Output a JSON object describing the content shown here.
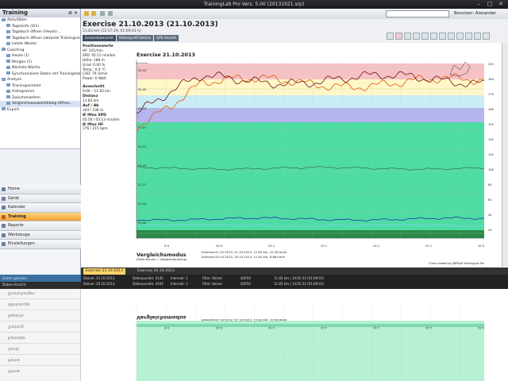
{
  "window": {
    "title": "TrainingLab Pro Vers. 5.00 (20131021.srp)"
  },
  "sidebar": {
    "title": "Training",
    "tree": [
      {
        "label": "Aktivitäten",
        "sel": false
      },
      {
        "label": "Tagesinfo (0/1)",
        "sel": false
      },
      {
        "label": "Tagebuch öffnen (Heute)...",
        "sel": false
      },
      {
        "label": "Tagebuch öffnen (aktuelle Trainingseinhe...",
        "sel": false
      },
      {
        "label": "Letzte Woche",
        "sel": false
      },
      {
        "label": "Coaching",
        "sel": false
      },
      {
        "label": "Heute (1)",
        "sel": false
      },
      {
        "label": "Morgen (1)",
        "sel": false
      },
      {
        "label": "Nächste Woche",
        "sel": false
      },
      {
        "label": "Synchronisiere Daten mit Trainingslab.com",
        "sel": false
      },
      {
        "label": "Analyse",
        "sel": false
      },
      {
        "label": "Trainingseinheit",
        "sel": false
      },
      {
        "label": "Histogramm",
        "sel": false
      },
      {
        "label": "Zwischenzeiten",
        "sel": false
      },
      {
        "label": "Vergleichsauswahldialog öffnen...",
        "sel": true
      },
      {
        "label": "Export",
        "sel": false
      }
    ],
    "nav": [
      {
        "label": "Home",
        "active": false
      },
      {
        "label": "Gerät",
        "active": false
      },
      {
        "label": "Kalender",
        "active": false
      },
      {
        "label": "Training",
        "active": true
      },
      {
        "label": "Reporte",
        "active": false
      },
      {
        "label": "Werkzeuge",
        "active": false
      },
      {
        "label": "Einstellungen",
        "active": false
      }
    ]
  },
  "toolbar": {
    "user": "Benutzer: Alexander"
  },
  "exercise": {
    "title": "Exercise 21.10.2013 (21.10.2013)",
    "subtitle": "11.83 km (12:57:29, 01:09:01 h)",
    "tabs": [
      "Gesamtübersicht",
      "Höhenprofil Details",
      "GPS Ansicht"
    ]
  },
  "info": {
    "pos_title": "Positionswerte",
    "pos": [
      "HF: 101/min",
      "SPD: 05:15 min/km",
      "Höhe: 188 m",
      "Grad: 0.00 %",
      "Temp.: 0.0 °C",
      "CAD: 79 U/min",
      "Power: 0 Watt"
    ],
    "sel_title": "Ausschnitt",
    "sel": "0:00 – 11.83 km",
    "dist_title": "Distanz",
    "dist": "11.83 km",
    "updown_title": "Auf / Ab",
    "updown": "344 / 336 m",
    "spd_title": "Ø /Max SPD",
    "spd": "05:50 / 03:13 min/km",
    "hf_title": "Ø /Max HF",
    "hf": "176 / 215 bpm"
  },
  "chart": {
    "title": "Exercise 21.10.2013",
    "ylabel": "min/km",
    "credit": "Chart created by SRPSoft TrainingLab Pro",
    "compare_title": "Vergleichsmodus",
    "compare_sub": "(Helle Kurven = Vergleichstraining)",
    "compare_line1": "Exercise:21.10.2013, 21.10.2013, 11.83 km, 10.28 km/h",
    "compare_line2": "Exercise:20.10.2013, 20.10.2013, 11.82 km, 8.88 km/h",
    "xticks": [
      "9.0",
      "10.0",
      "10.1",
      "10.1",
      "10.1",
      "10.1",
      "10.2"
    ],
    "pace_ticks": [
      "00:00",
      "00:40",
      "01:20",
      "01:07",
      "01:13",
      "01:20",
      "01:27",
      "01:33",
      "01:40"
    ],
    "hr_ticks": [
      "200",
      "180",
      "170",
      "160",
      "150",
      "140",
      "120",
      "100",
      "80",
      "60",
      "40",
      "20"
    ],
    "spin1": "1.30",
    "spin2": "0"
  },
  "bottom": {
    "tabs": [
      "Exercise 21.10.2013",
      "Exercise 20.10.2013"
    ],
    "stats": [
      "Datum: 21.10.2013,",
      "Datenpunkte: 4142",
      "Intervall: 1",
      "Filter: Keiner",
      "0/0/50",
      "11.83 km | 14:05:33 (01:09:01)",
      "Datum: 20.10.2013,",
      "Datenpunkte: 4104",
      "Intervall: 1",
      "Filter: Keiner",
      "0/0/50",
      "11.83 km | 14:05:33 (01:09:01)"
    ],
    "left": [
      "Daten geladen",
      "Daten-Ansicht"
    ]
  }
}
